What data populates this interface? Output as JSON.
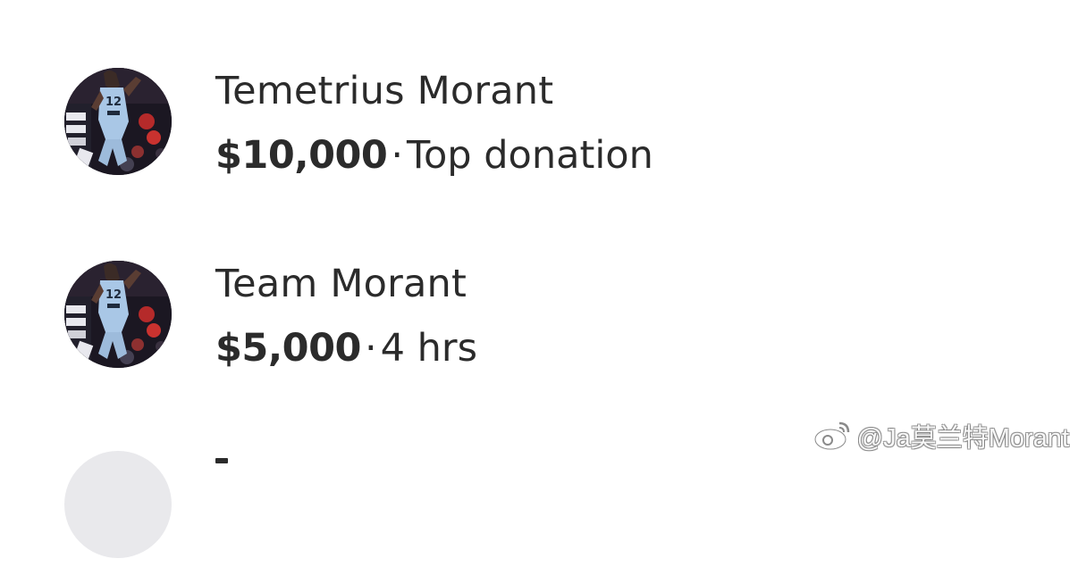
{
  "donations": [
    {
      "name": "Temetrius Morant",
      "amount": "$10,000",
      "separator": "·",
      "detail": "Top donation"
    },
    {
      "name": "Team Morant",
      "amount": "$5,000",
      "separator": "·",
      "detail": "4 hrs"
    }
  ],
  "avatar": {
    "jersey_number": "12",
    "icon": "player-photo-avatar"
  },
  "watermark": {
    "text": "@Ja莫兰特Morant",
    "icon": "weibo-logo-icon"
  },
  "colors": {
    "text": "#2b2b2b",
    "background": "#ffffff",
    "jersey": "#a9c7e6"
  }
}
